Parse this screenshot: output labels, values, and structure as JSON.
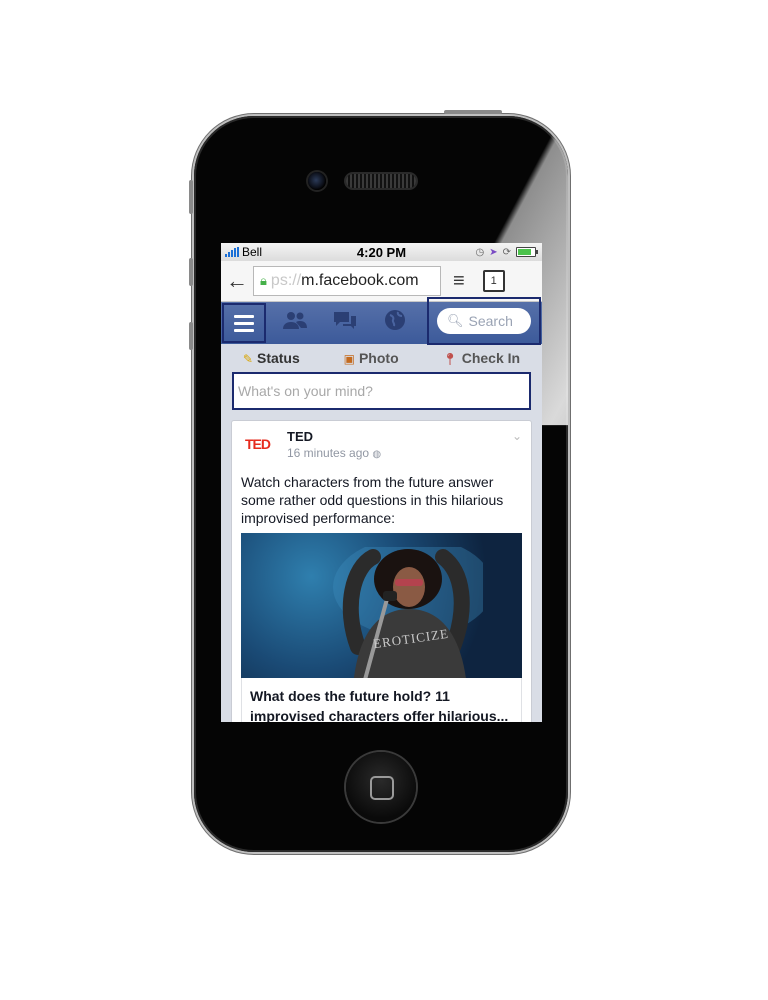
{
  "status_bar": {
    "carrier": "Bell",
    "time": "4:20 PM"
  },
  "browser": {
    "url_scheme": "ps://",
    "url_host": "m.facebook.com",
    "tab_count": "1"
  },
  "fb_nav": {
    "search_placeholder": "Search"
  },
  "composer": {
    "status_label": "Status",
    "photo_label": "Photo",
    "checkin_label": "Check In",
    "input_placeholder": "What's on your mind?"
  },
  "post": {
    "logo": "TED",
    "author": "TED",
    "time": "16 minutes ago",
    "text": "Watch characters from the future answer some rather odd questions in this hilarious improvised performance:",
    "shirt_text": "EROTICIZE",
    "link_title": "What does the future hold? 11 improvised characters offer hilarious..."
  },
  "colors": {
    "fb_blue": "#3c5a9a",
    "highlight_outline": "#1b2a6e",
    "ted_red": "#e62b1e"
  }
}
